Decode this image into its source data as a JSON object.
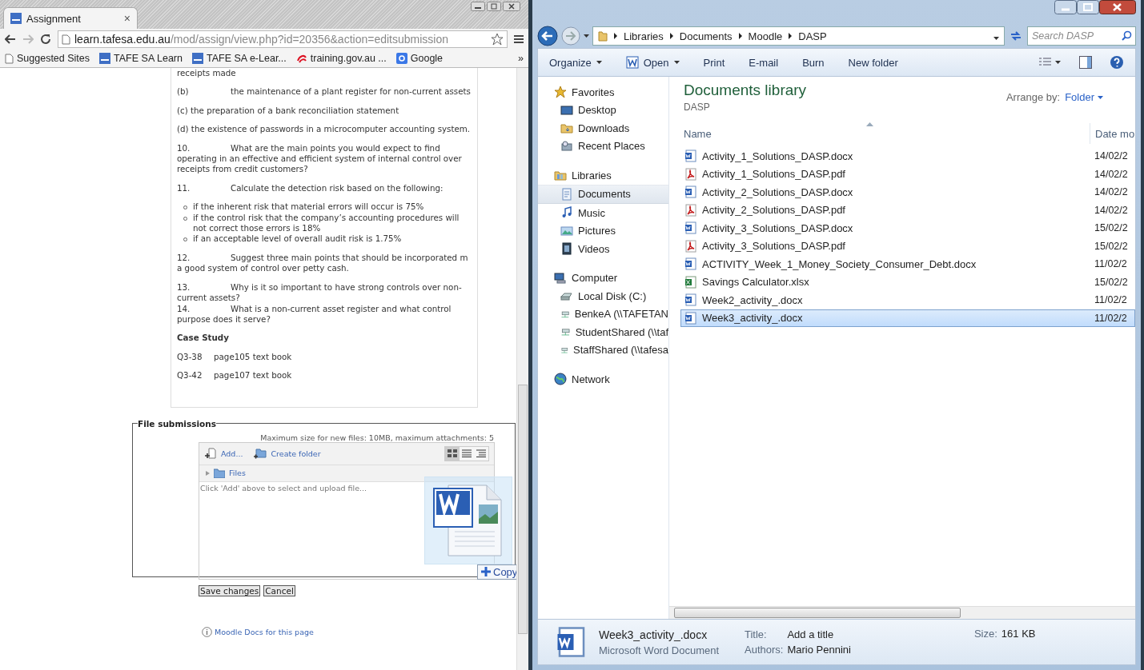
{
  "browser": {
    "tab": {
      "title": "Assignment",
      "close": "×"
    },
    "url": {
      "host": "learn.tafesa.edu.au",
      "path": "/mod/assign/view.php?id=20356&action=editsubmission"
    },
    "bookmarks": [
      {
        "label": "Suggested Sites",
        "kind": "page"
      },
      {
        "label": "TAFE SA Learn",
        "kind": "tafe"
      },
      {
        "label": "TAFE SA e-Lear...",
        "kind": "tafe"
      },
      {
        "label": "training.gov.au ...",
        "kind": "training"
      },
      {
        "label": "Google",
        "kind": "google"
      }
    ],
    "bookmarks_overflow": "»"
  },
  "assignment": {
    "content": [
      {
        "kind": "para",
        "text": "receipts made"
      },
      {
        "kind": "numbered",
        "number": "(b)",
        "text": "the maintenance  of a plant register  for non-current assets"
      },
      {
        "kind": "para",
        "text": "(c)  the preparation  of  a bank  reconciliation  statement"
      },
      {
        "kind": "para",
        "text": "(d)  the existence of passwords in a microcomputer  accounting system."
      },
      {
        "kind": "numbered",
        "number": "10.",
        "text": "What are the main points you would expect to find operating  in an effective and efficient system of internal control over receipts from credit customers?"
      },
      {
        "kind": "numbered",
        "number": "11.",
        "text": "Calculate the detection risk based on the following:"
      },
      {
        "kind": "bullets",
        "items": [
          "if the inherent risk that material errors will occur is 75%",
          "if the control risk that the company’s accounting procedures will not correct those errors is 18%",
          "if an acceptable level of overall audit risk is 1.75%"
        ]
      },
      {
        "kind": "numbered",
        "number": " 12.",
        "text": "Suggest three main points that should be incorporated m a good system of control over petty cash."
      },
      {
        "kind": "numbered_tight",
        "number": "13.",
        "text": "Why is it so important to have strong controls over non-current assets?"
      },
      {
        "kind": "numbered",
        "number": "14.",
        "text": "What is a non-current asset register and what control purpose does it serve?"
      },
      {
        "kind": "heading",
        "text": "Case Study"
      },
      {
        "kind": "reference",
        "number": "Q3-38",
        "text": "page105 text book"
      },
      {
        "kind": "reference",
        "number": "Q3-42",
        "text": "page107 text book"
      }
    ]
  },
  "file_submissions": {
    "legend": "File submissions",
    "limits": "Maximum size for new files: 10MB, maximum attachments: 5",
    "actions": [
      {
        "label": "Add...",
        "kind": "add"
      },
      {
        "label": "Create folder",
        "kind": "folder"
      }
    ],
    "views": [
      {
        "kind": "icons",
        "selected": true
      },
      {
        "kind": "list",
        "selected": false
      },
      {
        "kind": "tree",
        "selected": false
      }
    ],
    "path": "Files",
    "hint": "Click 'Add' above to select and upload file...",
    "drag": {
      "kind": "word",
      "effect": "Copy"
    }
  },
  "form_buttons": [
    "Save changes",
    "Cancel"
  ],
  "docs_link": "Moodle Docs for this page",
  "explorer": {
    "breadcrumb": [
      "Libraries",
      "Documents",
      "Moodle",
      "DASP"
    ],
    "search": {
      "placeholder": "Search DASP"
    },
    "toolbar": [
      {
        "label": "Organize",
        "kind": "menu"
      },
      {
        "label": "Open",
        "kind": "open"
      },
      {
        "label": "Print",
        "kind": "plain"
      },
      {
        "label": "E-mail",
        "kind": "plain"
      },
      {
        "label": "Burn",
        "kind": "plain"
      },
      {
        "label": "New folder",
        "kind": "plain"
      }
    ],
    "nav": [
      {
        "label": "Favorites",
        "kind": "star",
        "selected": false,
        "children": [
          {
            "label": "Desktop",
            "kind": "desktop",
            "selected": false
          },
          {
            "label": "Downloads",
            "kind": "folder",
            "selected": false
          },
          {
            "label": "Recent Places",
            "kind": "recent",
            "selected": false
          }
        ]
      },
      {
        "label": "Libraries",
        "kind": "library",
        "selected": false,
        "children": [
          {
            "label": "Documents",
            "kind": "documents",
            "selected": true
          },
          {
            "label": "Music",
            "kind": "music",
            "selected": false
          },
          {
            "label": "Pictures",
            "kind": "pictures",
            "selected": false
          },
          {
            "label": "Videos",
            "kind": "videos",
            "selected": false
          }
        ]
      },
      {
        "label": "Computer",
        "kind": "computer",
        "selected": false,
        "children": [
          {
            "label": "Local Disk (C:)",
            "kind": "disk",
            "selected": false
          },
          {
            "label": "BenkeA (\\\\TAFETAN",
            "kind": "netdrive",
            "selected": false
          },
          {
            "label": "StudentShared (\\\\taf",
            "kind": "netdrive",
            "selected": false
          },
          {
            "label": "StaffShared (\\\\tafesa",
            "kind": "netdrive",
            "selected": false
          }
        ]
      },
      {
        "label": "Network",
        "kind": "network",
        "selected": false
      }
    ],
    "library": {
      "title": "Documents library",
      "subtitle": "DASP",
      "arrange_label": "Arrange by:",
      "arrange_value": "Folder"
    },
    "columns": [
      "Name",
      "Date mo"
    ],
    "files": [
      {
        "name": "Activity_1_Solutions_DASP.docx",
        "kind": "docx",
        "date": "14/02/2",
        "selected": false
      },
      {
        "name": "Activity_1_Solutions_DASP.pdf",
        "kind": "pdf",
        "date": "14/02/2",
        "selected": false
      },
      {
        "name": "Activity_2_Solutions_DASP.docx",
        "kind": "docx",
        "date": "14/02/2",
        "selected": false
      },
      {
        "name": "Activity_2_Solutions_DASP.pdf",
        "kind": "pdf",
        "date": "14/02/2",
        "selected": false
      },
      {
        "name": "Activity_3_Solutions_DASP.docx",
        "kind": "docx",
        "date": "15/02/2",
        "selected": false
      },
      {
        "name": "Activity_3_Solutions_DASP.pdf",
        "kind": "pdf",
        "date": "15/02/2",
        "selected": false
      },
      {
        "name": "ACTIVITY_Week_1_Money_Society_Consumer_Debt.docx",
        "kind": "docx",
        "date": "11/02/2",
        "selected": false
      },
      {
        "name": "Savings Calculator.xlsx",
        "kind": "xlsx",
        "date": "15/02/2",
        "selected": false
      },
      {
        "name": "Week2_activity_.docx",
        "kind": "docx",
        "date": "11/02/2",
        "selected": false
      },
      {
        "name": "Week3_activity_.docx",
        "kind": "docx",
        "date": "11/02/2",
        "selected": true
      }
    ],
    "details": {
      "name": "Week3_activity_.docx",
      "type": "Microsoft Word Document",
      "kind": "docx",
      "fields": [
        {
          "label": "Title:",
          "value": "Add a title"
        },
        {
          "label": "Authors:",
          "value": "Mario Pennini"
        },
        {
          "label": "Size:",
          "value": "161 KB"
        }
      ]
    }
  }
}
